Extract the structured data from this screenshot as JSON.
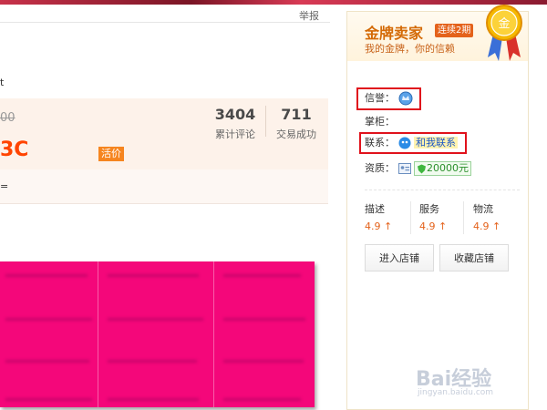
{
  "report_label": "举报",
  "tiny_mark": "t",
  "product": {
    "old_price_fragment": "00",
    "new_price_fragment": "3C",
    "price_tag": "活价"
  },
  "stats": [
    {
      "value": "3404",
      "label": "累计评论"
    },
    {
      "value": "711",
      "label": "交易成功"
    }
  ],
  "sub_mark": "=",
  "seller": {
    "title": "金牌卖家",
    "badge": "连续2期",
    "subtitle": "我的金牌，你的信赖",
    "medal_char": "金",
    "credit_label": "信誉：",
    "keeper_label": "掌柜：",
    "contact_label": "联系：",
    "contact_link": "和我联系",
    "qualification_label": "资质：",
    "qualification_value": "20000元",
    "scores": [
      {
        "label": "描述",
        "value": "4.9"
      },
      {
        "label": "服务",
        "value": "4.9"
      },
      {
        "label": "物流",
        "value": "4.9"
      }
    ],
    "enter_shop": "进入店铺",
    "favorite_shop": "收藏店铺"
  },
  "watermark": {
    "text": "Bai经验",
    "url": "jingyan.baidu.com"
  },
  "colors": {
    "accent": "#f40",
    "magenta": "#f4077a",
    "highlight_frame": "#e0121c",
    "gold": "#d46a06"
  }
}
